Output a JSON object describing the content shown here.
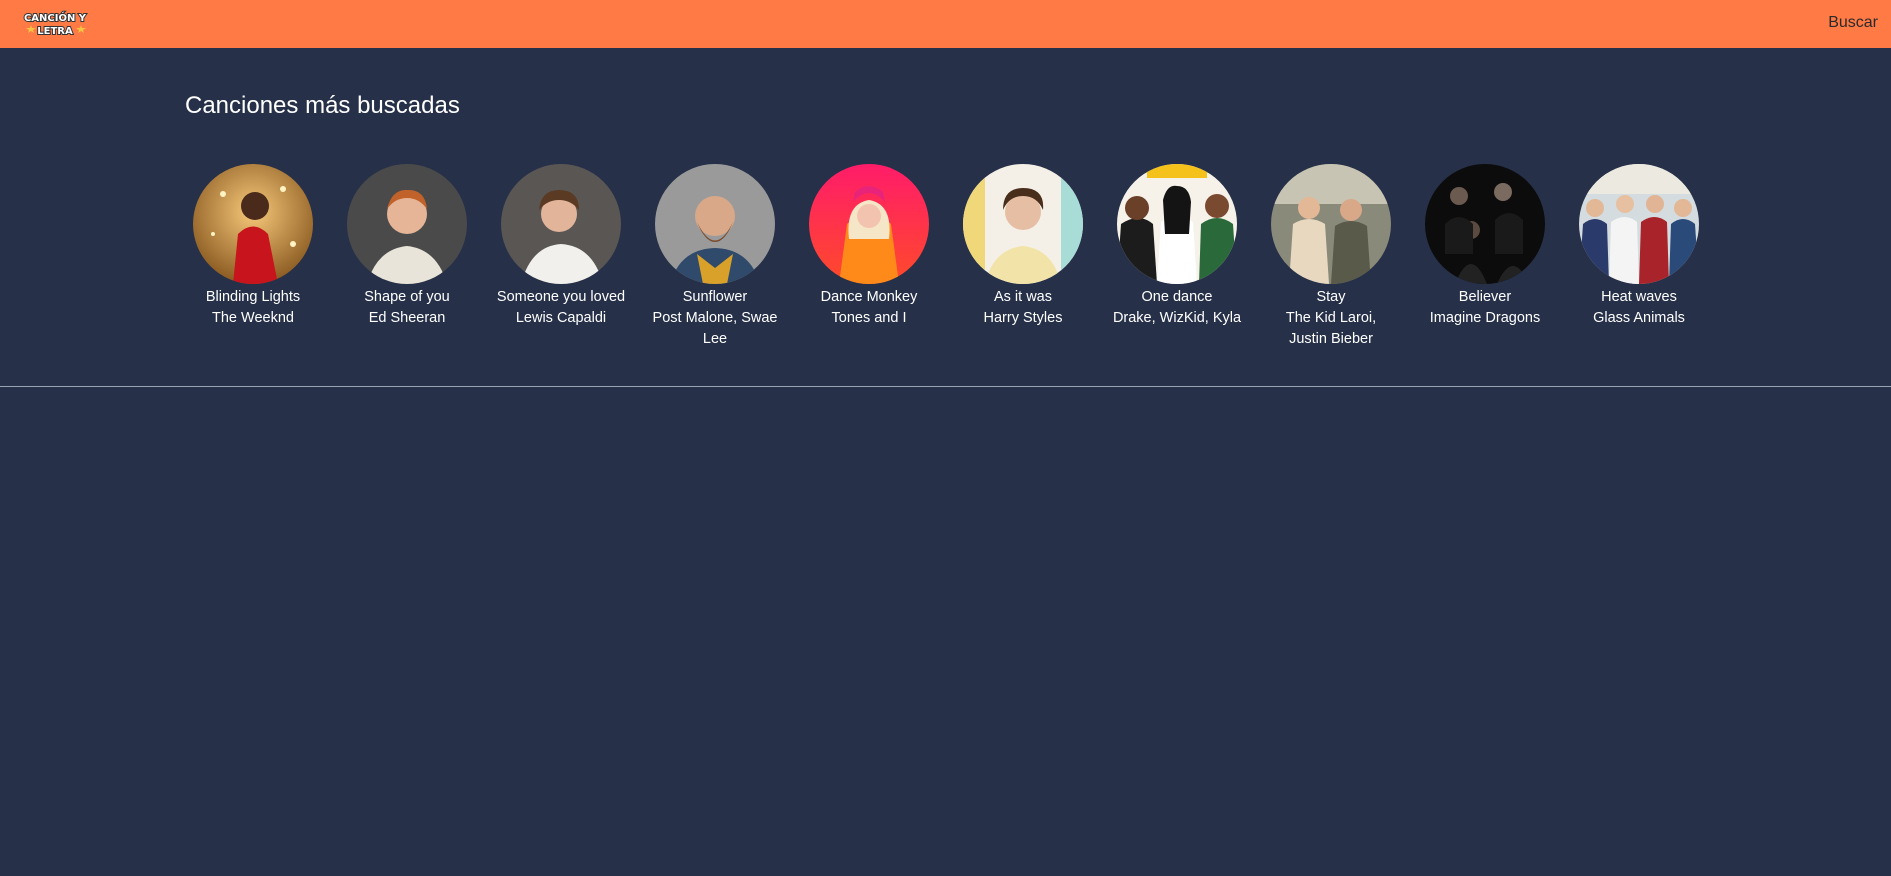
{
  "header": {
    "logo_text": "CANCIÓN Y LETRA",
    "search_label": "Buscar"
  },
  "main": {
    "title": "Canciones más buscadas",
    "songs": [
      {
        "title": "Blinding Lights",
        "artist": "The Weeknd",
        "photo_icon": "artist-photo-icon"
      },
      {
        "title": "Shape of you",
        "artist": "Ed Sheeran",
        "photo_icon": "artist-photo-icon"
      },
      {
        "title": "Someone you loved",
        "artist": "Lewis Capaldi",
        "photo_icon": "artist-photo-icon"
      },
      {
        "title": "Sunflower",
        "artist": "Post Malone, Swae Lee",
        "photo_icon": "artist-photo-icon"
      },
      {
        "title": "Dance Monkey",
        "artist": "Tones and I",
        "photo_icon": "artist-photo-icon"
      },
      {
        "title": "As it was",
        "artist": "Harry Styles",
        "photo_icon": "artist-photo-icon"
      },
      {
        "title": "One dance",
        "artist": "Drake, WizKid, Kyla",
        "photo_icon": "artist-photo-icon"
      },
      {
        "title": "Stay",
        "artist": "The Kid Laroi, Justin Bieber",
        "photo_icon": "artist-photo-icon"
      },
      {
        "title": "Believer",
        "artist": "Imagine Dragons",
        "photo_icon": "artist-photo-icon"
      },
      {
        "title": "Heat waves",
        "artist": "Glass Animals",
        "photo_icon": "artist-photo-icon"
      }
    ]
  },
  "colors": {
    "header_bg": "#ff7a45",
    "page_bg": "#263048",
    "text": "#ffffff"
  }
}
